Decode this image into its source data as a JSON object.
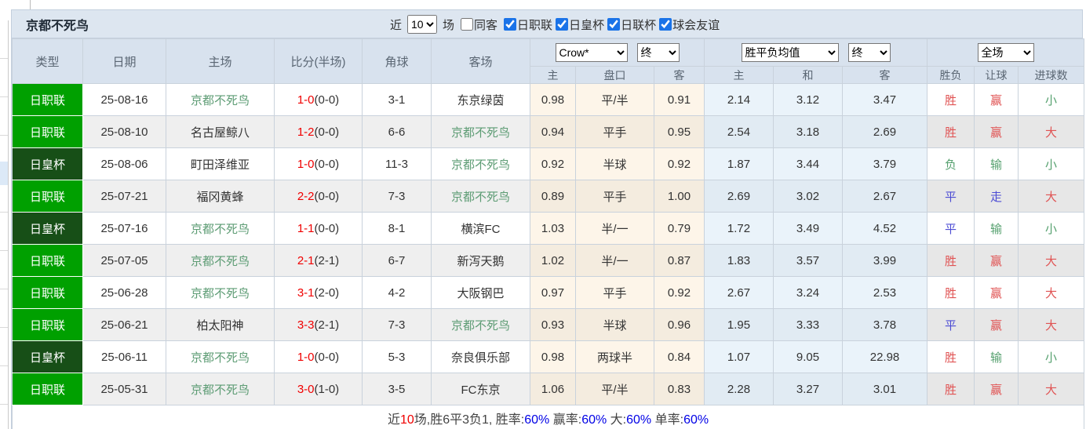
{
  "header": {
    "team": "京都不死鸟",
    "recent_label": "近",
    "recent_value": "10",
    "matches_label": "场",
    "same_away_label": "同客",
    "same_away_checked": false,
    "league_filters": [
      {
        "label": "日职联",
        "checked": true
      },
      {
        "label": "日皇杯",
        "checked": true
      },
      {
        "label": "日联杯",
        "checked": true
      },
      {
        "label": "球会友谊",
        "checked": true
      }
    ]
  },
  "table": {
    "main_headers": [
      "类型",
      "日期",
      "主场",
      "比分(半场)",
      "角球",
      "客场"
    ],
    "group_selects": {
      "odds_company": "Crow*",
      "odds_time": "终",
      "avg_label": "胜平负均值",
      "avg_time": "终",
      "scope": "全场"
    },
    "sub_headers": [
      "主",
      "盘口",
      "客",
      "主",
      "和",
      "客",
      "胜负",
      "让球",
      "进球数"
    ],
    "rows": [
      {
        "league": "日职联",
        "league_style": "jleague",
        "date": "25-08-16",
        "home": "京都不死鸟",
        "home_team": true,
        "score": "1-0",
        "half": "(0-0)",
        "corners": "3-1",
        "away": "东京绿茵",
        "away_team": false,
        "crow_home": "0.98",
        "handicap": "平/半",
        "crow_away": "0.91",
        "avg_home": "2.14",
        "avg_draw": "3.12",
        "avg_away": "3.47",
        "result": "胜",
        "result_color": "red",
        "handicap_result": "赢",
        "handicap_color": "red",
        "goals": "小",
        "goals_color": "green"
      },
      {
        "league": "日职联",
        "league_style": "jleague",
        "date": "25-08-10",
        "home": "名古屋鲸八",
        "home_team": false,
        "score": "1-2",
        "half": "(0-0)",
        "corners": "6-6",
        "away": "京都不死鸟",
        "away_team": true,
        "crow_home": "0.94",
        "handicap": "平手",
        "crow_away": "0.95",
        "avg_home": "2.54",
        "avg_draw": "3.18",
        "avg_away": "2.69",
        "result": "胜",
        "result_color": "red",
        "handicap_result": "赢",
        "handicap_color": "red",
        "goals": "大",
        "goals_color": "red"
      },
      {
        "league": "日皇杯",
        "league_style": "cup",
        "date": "25-08-06",
        "home": "町田泽维亚",
        "home_team": false,
        "score": "1-0",
        "half": "(0-0)",
        "corners": "11-3",
        "away": "京都不死鸟",
        "away_team": true,
        "crow_home": "0.92",
        "handicap": "半球",
        "crow_away": "0.92",
        "avg_home": "1.87",
        "avg_draw": "3.44",
        "avg_away": "3.79",
        "result": "负",
        "result_color": "green",
        "handicap_result": "输",
        "handicap_color": "green",
        "goals": "小",
        "goals_color": "green"
      },
      {
        "league": "日职联",
        "league_style": "jleague",
        "date": "25-07-21",
        "home": "福冈黄蜂",
        "home_team": false,
        "score": "2-2",
        "half": "(0-0)",
        "corners": "7-3",
        "away": "京都不死鸟",
        "away_team": true,
        "crow_home": "0.89",
        "handicap": "平手",
        "crow_away": "1.00",
        "avg_home": "2.69",
        "avg_draw": "3.02",
        "avg_away": "2.67",
        "result": "平",
        "result_color": "blue",
        "handicap_result": "走",
        "handicap_color": "blue",
        "goals": "大",
        "goals_color": "red"
      },
      {
        "league": "日皇杯",
        "league_style": "cup",
        "date": "25-07-16",
        "home": "京都不死鸟",
        "home_team": true,
        "score": "1-1",
        "half": "(0-0)",
        "corners": "8-1",
        "away": "横滨FC",
        "away_team": false,
        "crow_home": "1.03",
        "handicap": "半/一",
        "crow_away": "0.79",
        "avg_home": "1.72",
        "avg_draw": "3.49",
        "avg_away": "4.52",
        "result": "平",
        "result_color": "blue",
        "handicap_result": "输",
        "handicap_color": "green",
        "goals": "小",
        "goals_color": "green"
      },
      {
        "league": "日职联",
        "league_style": "jleague",
        "date": "25-07-05",
        "home": "京都不死鸟",
        "home_team": true,
        "score": "2-1",
        "half": "(2-1)",
        "corners": "6-7",
        "away": "新泻天鹅",
        "away_team": false,
        "crow_home": "1.02",
        "handicap": "半/一",
        "crow_away": "0.87",
        "avg_home": "1.83",
        "avg_draw": "3.57",
        "avg_away": "3.99",
        "result": "胜",
        "result_color": "red",
        "handicap_result": "赢",
        "handicap_color": "red",
        "goals": "大",
        "goals_color": "red"
      },
      {
        "league": "日职联",
        "league_style": "jleague",
        "date": "25-06-28",
        "home": "京都不死鸟",
        "home_team": true,
        "score": "3-1",
        "half": "(2-0)",
        "corners": "4-2",
        "away": "大阪钢巴",
        "away_team": false,
        "crow_home": "0.97",
        "handicap": "平手",
        "crow_away": "0.92",
        "avg_home": "2.67",
        "avg_draw": "3.24",
        "avg_away": "2.53",
        "result": "胜",
        "result_color": "red",
        "handicap_result": "赢",
        "handicap_color": "red",
        "goals": "大",
        "goals_color": "red"
      },
      {
        "league": "日职联",
        "league_style": "jleague",
        "date": "25-06-21",
        "home": "柏太阳神",
        "home_team": false,
        "score": "3-3",
        "half": "(2-1)",
        "corners": "7-3",
        "away": "京都不死鸟",
        "away_team": true,
        "crow_home": "0.93",
        "handicap": "半球",
        "crow_away": "0.96",
        "avg_home": "1.95",
        "avg_draw": "3.33",
        "avg_away": "3.78",
        "result": "平",
        "result_color": "blue",
        "handicap_result": "赢",
        "handicap_color": "red",
        "goals": "大",
        "goals_color": "red"
      },
      {
        "league": "日皇杯",
        "league_style": "cup",
        "date": "25-06-11",
        "home": "京都不死鸟",
        "home_team": true,
        "score": "1-0",
        "half": "(0-0)",
        "corners": "5-3",
        "away": "奈良俱乐部",
        "away_team": false,
        "crow_home": "0.98",
        "handicap": "两球半",
        "crow_away": "0.84",
        "avg_home": "1.07",
        "avg_draw": "9.05",
        "avg_away": "22.98",
        "result": "胜",
        "result_color": "red",
        "handicap_result": "输",
        "handicap_color": "green",
        "goals": "小",
        "goals_color": "green"
      },
      {
        "league": "日职联",
        "league_style": "jleague",
        "date": "25-05-31",
        "home": "京都不死鸟",
        "home_team": true,
        "score": "3-0",
        "half": "(1-0)",
        "corners": "3-5",
        "away": "FC东京",
        "away_team": false,
        "crow_home": "1.06",
        "handicap": "平/半",
        "crow_away": "0.83",
        "avg_home": "2.28",
        "avg_draw": "3.27",
        "avg_away": "3.01",
        "result": "胜",
        "result_color": "red",
        "handicap_result": "赢",
        "handicap_color": "red",
        "goals": "大",
        "goals_color": "red"
      }
    ]
  },
  "summary": {
    "segments": [
      {
        "text": "近",
        "color": "plain"
      },
      {
        "text": "10",
        "color": "red"
      },
      {
        "text": "场,胜6平3负1, 胜率:",
        "color": "plain"
      },
      {
        "text": "60%",
        "color": "blue"
      },
      {
        "text": " 赢率:",
        "color": "plain"
      },
      {
        "text": "60%",
        "color": "blue"
      },
      {
        "text": " 大:",
        "color": "plain"
      },
      {
        "text": "60%",
        "color": "blue"
      },
      {
        "text": " 单率:",
        "color": "plain"
      },
      {
        "text": "60%",
        "color": "blue"
      }
    ]
  },
  "colors": {
    "jleague_green": "#00a000",
    "emperor_cup_green": "#174f17",
    "team_green": "#5d9c74",
    "score_red": "#f00000",
    "result_red": "#e05353",
    "result_blue": "#4d4dd4",
    "result_green": "#55a06e",
    "header_bg": "#dde6f0",
    "crow_col_bg": "#fdf5e9",
    "avg_col_bg": "#eaf3fa",
    "summary_red": "#f00000",
    "summary_blue": "#0000e6"
  }
}
